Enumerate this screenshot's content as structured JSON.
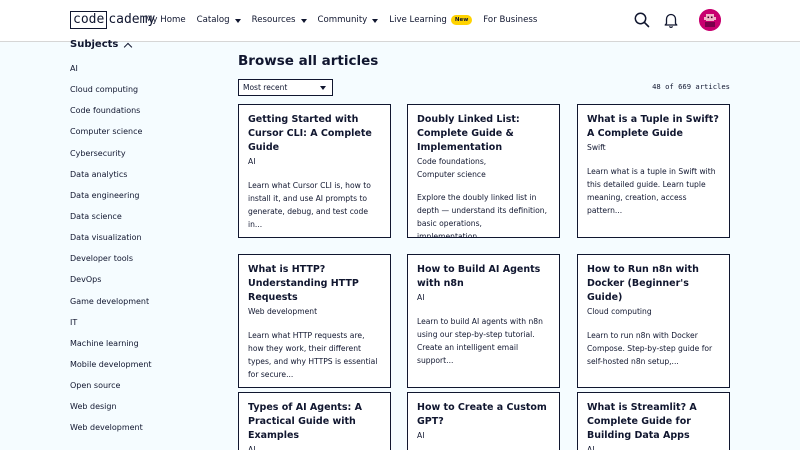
{
  "header": {
    "logo_code": "code",
    "logo_academy": "cademy",
    "nav": [
      {
        "label": "My Home",
        "dropdown": false
      },
      {
        "label": "Catalog",
        "dropdown": true
      },
      {
        "label": "Resources",
        "dropdown": true
      },
      {
        "label": "Community",
        "dropdown": true
      },
      {
        "label": "Live Learning",
        "dropdown": false,
        "badge": "New"
      },
      {
        "label": "For Business",
        "dropdown": false
      }
    ],
    "icons": [
      "search-icon",
      "bell-icon",
      "avatar"
    ]
  },
  "sidebar": {
    "heading": "Subjects",
    "items": [
      "AI",
      "Cloud computing",
      "Code foundations",
      "Computer science",
      "Cybersecurity",
      "Data analytics",
      "Data engineering",
      "Data science",
      "Data visualization",
      "Developer tools",
      "DevOps",
      "Game development",
      "IT",
      "Machine learning",
      "Mobile development",
      "Open source",
      "Web design",
      "Web development"
    ]
  },
  "main": {
    "title": "Browse all articles",
    "sort_value": "Most recent",
    "count": "48 of 669 articles",
    "cards": [
      {
        "title": "Getting Started with Cursor CLI: A Complete Guide",
        "tags": [
          "AI"
        ],
        "desc": "Learn what Cursor CLI is, how to install it, and use AI prompts to generate, debug, and test code in..."
      },
      {
        "title": "Doubly Linked List: Complete Guide & Implementation",
        "tags": [
          "Code foundations,",
          "Computer science"
        ],
        "desc": "Explore the doubly linked list in depth — understand its definition, basic operations, implementation,..."
      },
      {
        "title": "What is a Tuple in Swift? A Complete Guide",
        "tags": [
          "Swift"
        ],
        "desc": "Learn what is a tuple in Swift with this detailed guide. Learn tuple meaning, creation, access pattern..."
      },
      {
        "title": "What is HTTP? Understanding HTTP Requests",
        "tags": [
          "Web development"
        ],
        "desc": "Learn what HTTP requests are, how they work, their different types, and why HTTPS is essential for secure..."
      },
      {
        "title": "How to Build AI Agents with n8n",
        "tags": [
          "AI"
        ],
        "desc": "Learn to build AI agents with n8n using our step-by-step tutorial. Create an intelligent email support..."
      },
      {
        "title": "How to Run n8n with Docker (Beginner's Guide)",
        "tags": [
          "Cloud computing"
        ],
        "desc": "Learn to run n8n with Docker Compose. Step-by-step guide for self-hosted n8n setup,..."
      },
      {
        "title": "Types of AI Agents: A Practical Guide with Examples",
        "tags": [
          "AI"
        ],
        "desc": ""
      },
      {
        "title": "How to Create a Custom GPT?",
        "tags": [
          "AI"
        ],
        "desc": ""
      },
      {
        "title": "What is Streamlit? A Complete Guide for Building Data Apps",
        "tags": [
          "AI"
        ],
        "desc": ""
      }
    ]
  }
}
